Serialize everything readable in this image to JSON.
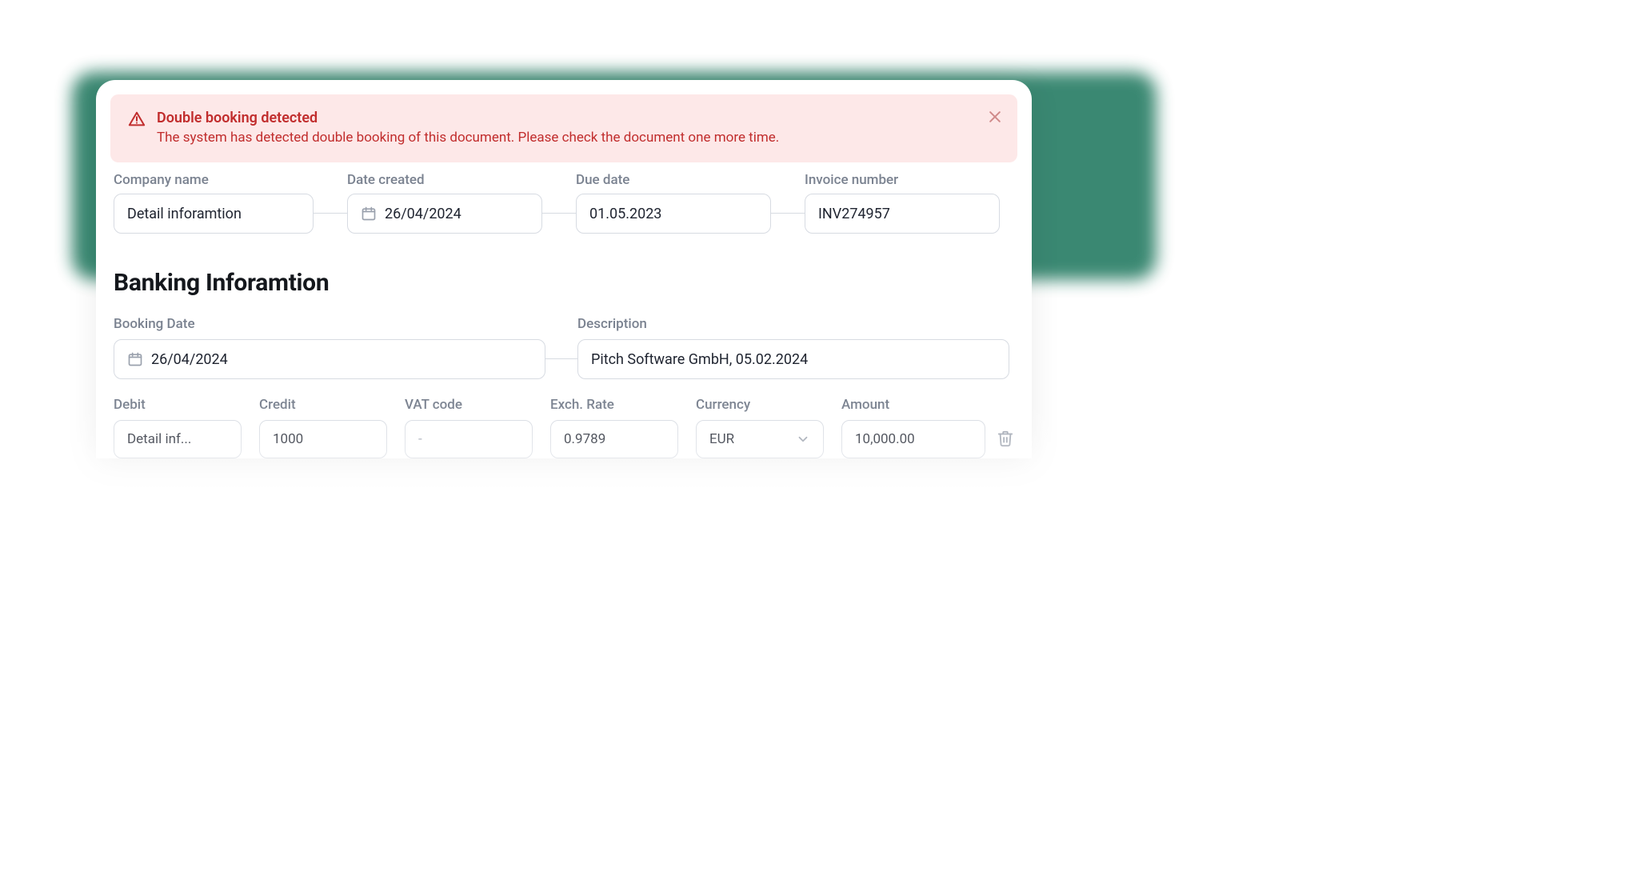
{
  "alert": {
    "title": "Double booking detected",
    "body": "The system has detected double booking of this document. Please check the document one more time."
  },
  "top_row": {
    "company_name": {
      "label": "Company name",
      "value": "Detail inforamtion"
    },
    "date_created": {
      "label": "Date created",
      "value": "26/04/2024"
    },
    "due_date": {
      "label": "Due date",
      "value": "01.05.2023"
    },
    "invoice_no": {
      "label": "Invoice number",
      "value": "INV274957"
    }
  },
  "section_title": "Banking Inforamtion",
  "banking": {
    "booking_date": {
      "label": "Booking Date",
      "value": "26/04/2024"
    },
    "description": {
      "label": "Description",
      "value": "Pitch Software GmbH, 05.02.2024"
    }
  },
  "line": {
    "debit": {
      "label": "Debit",
      "value": "Detail inf..."
    },
    "credit": {
      "label": "Credit",
      "value": "1000"
    },
    "vat": {
      "label": "VAT code",
      "value": "-"
    },
    "exch": {
      "label": "Exch. Rate",
      "value": "0.9789"
    },
    "currency": {
      "label": "Currency",
      "value": "EUR"
    },
    "amount": {
      "label": "Amount",
      "value": "10,000.00"
    }
  },
  "colors": {
    "alert_bg": "#fde8e8",
    "alert_fg": "#c12d2d",
    "accent_backdrop": "#0a6b4f",
    "border": "#d7dbe2",
    "label": "#7a8290"
  }
}
